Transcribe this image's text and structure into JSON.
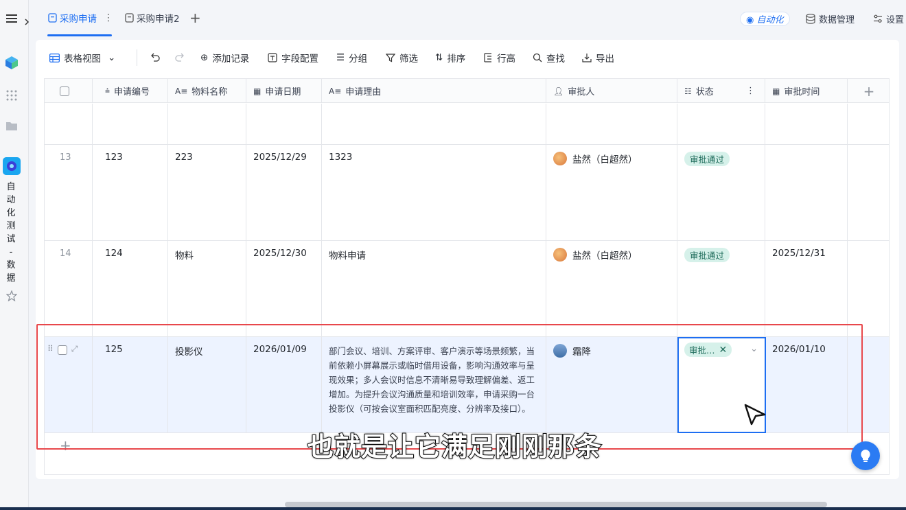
{
  "window": {
    "tabs": [
      {
        "label": "采购申请",
        "active": true
      },
      {
        "label": "采购申请2",
        "active": false
      }
    ],
    "automation_label": "自动化",
    "data_manage_label": "数据管理",
    "settings_label": "设置"
  },
  "sidebar": {
    "app_name_chars": [
      "自",
      "动",
      "化",
      "测",
      "试",
      "-",
      "数",
      "据"
    ]
  },
  "toolbar": {
    "view_label": "表格视图",
    "add_record": "添加记录",
    "field_config": "字段配置",
    "group": "分组",
    "filter": "筛选",
    "sort": "排序",
    "row_height": "行高",
    "find": "查找",
    "export": "导出"
  },
  "table": {
    "columns": [
      "申请编号",
      "物料名称",
      "申请日期",
      "申请理由",
      "审批人",
      "状态",
      "审批时间"
    ],
    "rows": [
      {
        "num": "13",
        "id": "123",
        "material": "223",
        "date": "2025/12/29",
        "reason": "1323",
        "approver": "盐然（白超然）",
        "status": "审批通过",
        "approve_time": ""
      },
      {
        "num": "14",
        "id": "124",
        "material": "物料",
        "date": "2025/12/30",
        "reason": "物料申请",
        "approver": "盐然（白超然）",
        "status": "审批通过",
        "approve_time": "2025/12/31"
      },
      {
        "num": "",
        "id": "125",
        "material": "投影仪",
        "date": "2026/01/09",
        "reason": "部门会议、培训、方案评审、客户演示等场景频繁，当前依赖小屏幕展示或临时借用设备，影响沟通效率与呈现效果；多人会议时信息不清晰易导致理解偏差、返工增加。为提升会议沟通质量和培训效率，申请采购一台投影仪（可按会议室面积匹配亮度、分辨率及接口）。",
        "approver": "霜降",
        "status": "审批…",
        "approve_time": "2026/01/10"
      }
    ]
  },
  "subtitle": "也就是让它满足刚刚那条",
  "colors": {
    "accent": "#1d6ef2",
    "status_bg": "#d6f1ea",
    "highlight": "#e8474b"
  }
}
